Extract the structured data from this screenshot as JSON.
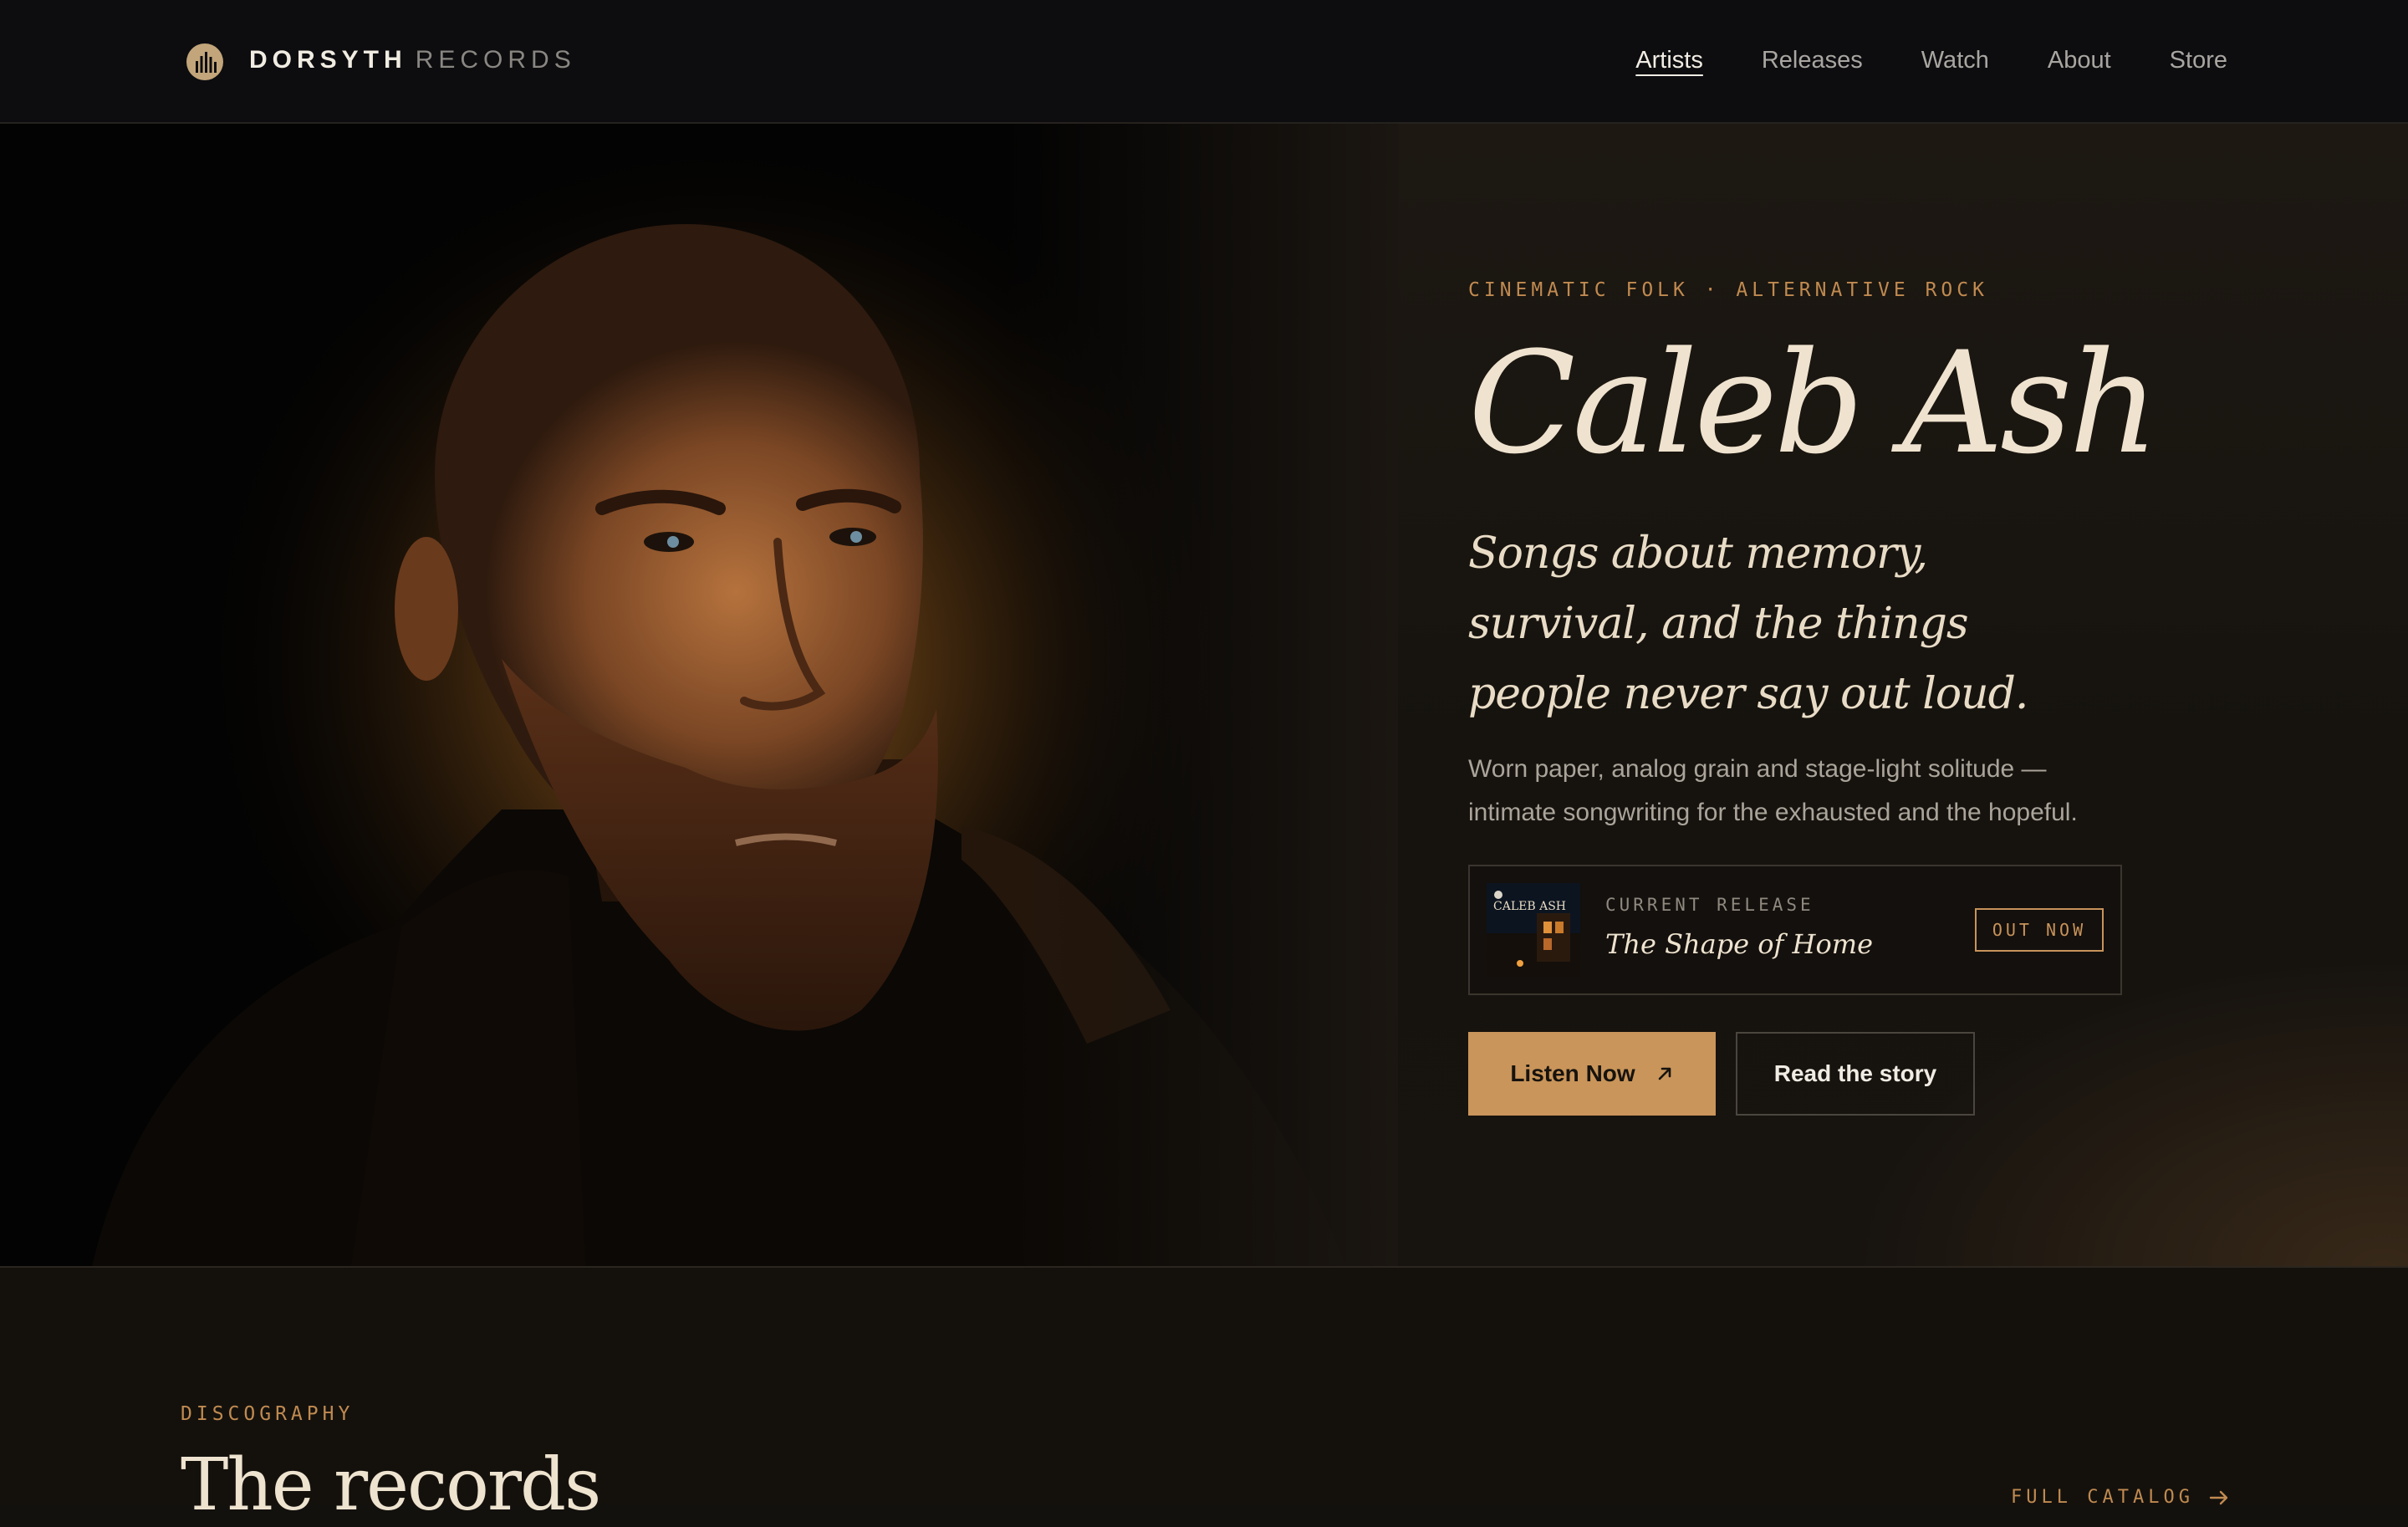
{
  "header": {
    "brand_main": "DORSYTH",
    "brand_sub": "RECORDS",
    "logo_icon": "sun-bars-icon",
    "nav": [
      {
        "label": "Artists",
        "active": true
      },
      {
        "label": "Releases",
        "active": false
      },
      {
        "label": "Watch",
        "active": false
      },
      {
        "label": "About",
        "active": false
      },
      {
        "label": "Store",
        "active": false
      }
    ]
  },
  "hero": {
    "genre": "CINEMATIC FOLK · ALTERNATIVE ROCK",
    "artist_name": "Caleb Ash",
    "tagline": "Songs about memory, survival, and the things people never say out loud.",
    "description": "Worn paper, analog grain and stage-light solitude — intimate songwriting for the exhausted and the hopeful.",
    "release": {
      "kicker": "CURRENT RELEASE",
      "title": "The Shape of Home",
      "badge": "OUT NOW",
      "cover_text": "CALEB ASH"
    },
    "primary_cta": "Listen Now",
    "primary_cta_icon": "arrow-up-right-icon",
    "secondary_cta": "Read the story"
  },
  "discography": {
    "kicker": "DISCOGRAPHY",
    "title": "The records",
    "link": "FULL CATALOG",
    "link_icon": "arrow-right-icon"
  },
  "colors": {
    "accent": "#c9955a",
    "header_bg": "#0d0d10",
    "page_bg": "#14110d",
    "cream": "#efe3cf"
  }
}
